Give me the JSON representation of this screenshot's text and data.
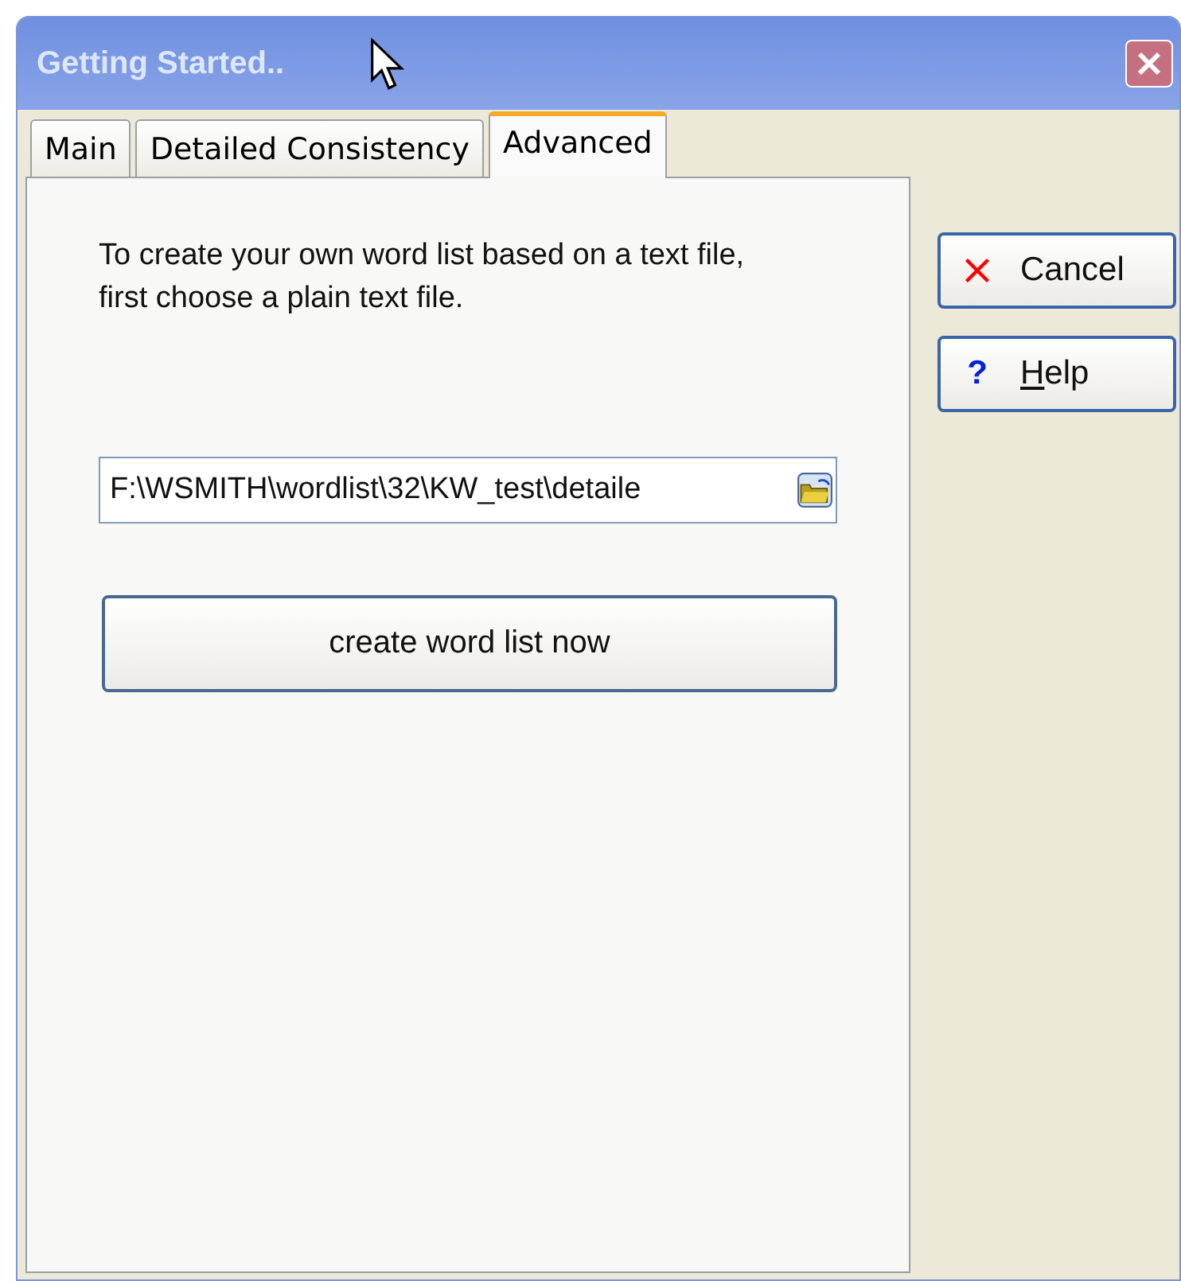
{
  "window": {
    "title": "Getting Started.."
  },
  "tabs": [
    {
      "label": "Main",
      "selected": false
    },
    {
      "label": "Detailed Consistency",
      "selected": false
    },
    {
      "label": "Advanced",
      "selected": true
    }
  ],
  "panel": {
    "instructions": "To create your own word list based on a text file, first choose a plain text file.",
    "file_field": {
      "value": "F:\\WSMITH\\wordlist\\32\\KW_test\\detaile"
    },
    "action_button": "create word list now"
  },
  "buttons": [
    {
      "kind": "cancel",
      "label": "Cancel",
      "mnemonic": false
    },
    {
      "kind": "help",
      "label": "Help",
      "mnemonic": true,
      "icon": "?"
    }
  ]
}
